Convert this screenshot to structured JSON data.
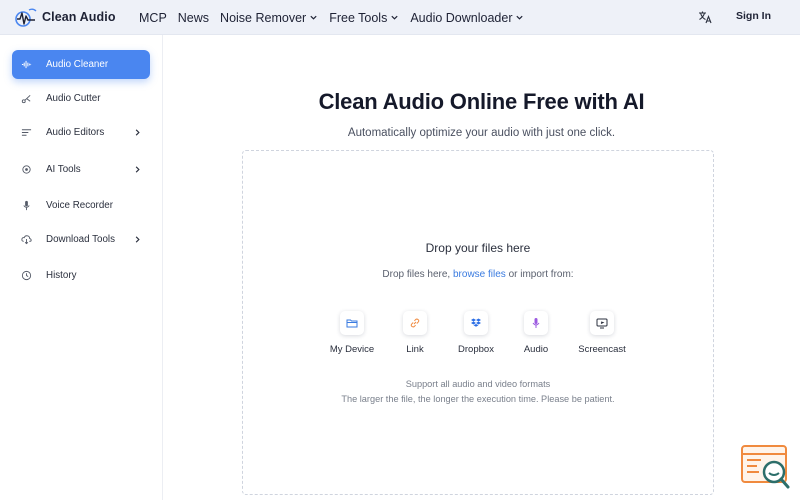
{
  "brand": {
    "name": "Clean Audio"
  },
  "nav": {
    "items": [
      {
        "label": "MCP",
        "has_dropdown": false
      },
      {
        "label": "News",
        "has_dropdown": false
      },
      {
        "label": "Noise Remover",
        "has_dropdown": true
      },
      {
        "label": "Free Tools",
        "has_dropdown": true
      },
      {
        "label": "Audio Downloader",
        "has_dropdown": true
      }
    ],
    "signin_label": "Sign In",
    "translate_icon": "translate-icon"
  },
  "sidebar": {
    "items": [
      {
        "label": "Audio Cleaner",
        "icon": "waveform-icon",
        "active": true,
        "has_submenu": false
      },
      {
        "label": "Audio Cutter",
        "icon": "scissors-icon",
        "active": false,
        "has_submenu": false
      },
      {
        "label": "Audio Editors",
        "icon": "sliders-icon",
        "active": false,
        "has_submenu": true
      },
      {
        "label": "AI Tools",
        "icon": "ai-icon",
        "active": false,
        "has_submenu": true
      },
      {
        "label": "Voice Recorder",
        "icon": "microphone-icon",
        "active": false,
        "has_submenu": false
      },
      {
        "label": "Download Tools",
        "icon": "cloud-download-icon",
        "active": false,
        "has_submenu": true
      },
      {
        "label": "History",
        "icon": "clock-icon",
        "active": false,
        "has_submenu": false
      }
    ]
  },
  "main": {
    "title": "Clean Audio Online Free with AI",
    "subtitle": "Automatically optimize your audio with just one click."
  },
  "dropzone": {
    "title": "Drop your files here",
    "sub_before": "Drop files here, ",
    "sub_link": "browse files",
    "sub_after": " or import from:",
    "sources": [
      {
        "label": "My Device",
        "icon": "folder-icon"
      },
      {
        "label": "Link",
        "icon": "link-icon"
      },
      {
        "label": "Dropbox",
        "icon": "dropbox-icon"
      },
      {
        "label": "Audio",
        "icon": "microphone-icon"
      },
      {
        "label": "Screencast",
        "icon": "screen-icon"
      }
    ],
    "note1": "Support all audio and video formats",
    "note2": "The larger the file, the longer the execution time. Please be patient."
  },
  "colors": {
    "accent": "#4a86f0",
    "link": "#3a7be0",
    "widget": "#f08a3e"
  }
}
